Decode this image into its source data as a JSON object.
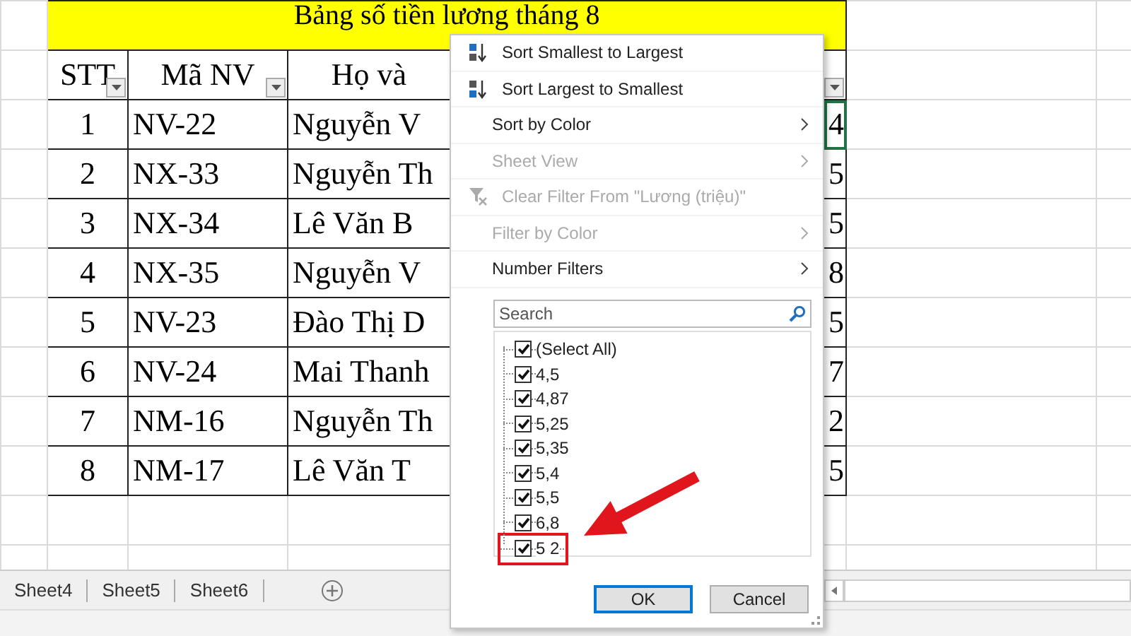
{
  "sheet": {
    "title": "Bảng số tiền lương tháng 8",
    "columns": [
      {
        "label": "STT",
        "filter_button": true
      },
      {
        "label": "Mã NV",
        "filter_button": true
      },
      {
        "label": "Họ và",
        "filter_button": false
      },
      {
        "filter_button": true
      }
    ],
    "rows": [
      {
        "cells": [
          "1",
          "NV-22",
          "Nguyễn V",
          "4"
        ],
        "active_cell": true
      },
      {
        "cells": [
          "2",
          "NX-33",
          "Nguyễn Th",
          "5"
        ],
        "active_cell": false
      },
      {
        "cells": [
          "3",
          "NX-34",
          "Lê Văn B",
          "5"
        ],
        "active_cell": false
      },
      {
        "cells": [
          "4",
          "NX-35",
          "Nguyễn V",
          "8"
        ],
        "active_cell": false
      },
      {
        "cells": [
          "5",
          "NV-23",
          "Đào Thị D",
          "5"
        ],
        "active_cell": false
      },
      {
        "cells": [
          "6",
          "NV-24",
          "Mai Thanh",
          "7"
        ],
        "active_cell": false
      },
      {
        "cells": [
          "7",
          "NM-16",
          "Nguyễn Th",
          "2"
        ],
        "active_cell": false
      },
      {
        "cells": [
          "8",
          "NM-17",
          "Lê Văn T",
          "5"
        ],
        "active_cell": false
      }
    ]
  },
  "sheet_tabs": [
    {
      "label": "Sheet4",
      "selected": false
    },
    {
      "label": "Sheet5",
      "selected": false
    },
    {
      "label": "Sheet6",
      "selected": false
    }
  ],
  "filter_menu": {
    "items": [
      {
        "kind": "sort_ascending",
        "label": "Sort Smallest to Largest",
        "disabled": false
      },
      {
        "kind": "sort_descending",
        "label": "Sort Largest to Smallest",
        "disabled": false
      },
      {
        "kind": "submenu",
        "label": "Sort by Color",
        "disabled": false
      },
      {
        "kind": "submenu",
        "label": "Sheet View",
        "disabled": true
      },
      {
        "kind": "clear_filter",
        "label": "Clear Filter From \"Lương (triệu)\"",
        "disabled": true
      },
      {
        "kind": "submenu",
        "label": "Filter by Color",
        "disabled": true
      },
      {
        "kind": "submenu",
        "label": "Number Filters",
        "disabled": false
      }
    ],
    "search": {
      "placeholder": "Search"
    },
    "values": [
      {
        "label": "(Select All)",
        "checked": true,
        "highlighted": false
      },
      {
        "label": "4,5",
        "checked": true,
        "highlighted": false
      },
      {
        "label": "4,87",
        "checked": true,
        "highlighted": false
      },
      {
        "label": "5,25",
        "checked": true,
        "highlighted": false
      },
      {
        "label": "5,35",
        "checked": true,
        "highlighted": false
      },
      {
        "label": "5,4",
        "checked": true,
        "highlighted": false
      },
      {
        "label": "5,5",
        "checked": true,
        "highlighted": false
      },
      {
        "label": "6,8",
        "checked": true,
        "highlighted": false
      },
      {
        "label": "5 2",
        "checked": true,
        "highlighted": true
      }
    ],
    "callout_arrow": true,
    "buttons": [
      {
        "label": "OK",
        "default": true
      },
      {
        "label": "Cancel",
        "default": false
      }
    ]
  }
}
